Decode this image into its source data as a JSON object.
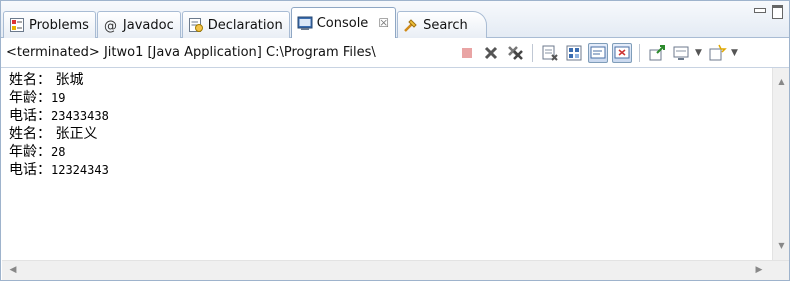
{
  "tabs": [
    {
      "label": "Problems",
      "icon": "problems-icon"
    },
    {
      "label": "Javadoc",
      "icon": "javadoc-icon"
    },
    {
      "label": "Declaration",
      "icon": "declaration-icon"
    },
    {
      "label": "Console",
      "icon": "console-icon",
      "active": true,
      "close": "☒"
    },
    {
      "label": "Search",
      "icon": "search-icon"
    }
  ],
  "toolbar": {
    "process_label": "<terminated> Jitwo1 [Java Application] C:\\Program Files\\"
  },
  "console": {
    "lines": [
      {
        "label": "姓名：",
        "value": " 张城",
        "cjk": true
      },
      {
        "label": "年龄：",
        "value": "19"
      },
      {
        "label": "电话：",
        "value": "23433438"
      },
      {
        "label": "姓名：",
        "value": " 张正义",
        "cjk": true
      },
      {
        "label": "年龄：",
        "value": "28"
      },
      {
        "label": "电话：",
        "value": "12324343"
      }
    ]
  },
  "colors": {
    "accent": "#9eb3cc",
    "tab_gradient_end": "#e4ebf4"
  }
}
